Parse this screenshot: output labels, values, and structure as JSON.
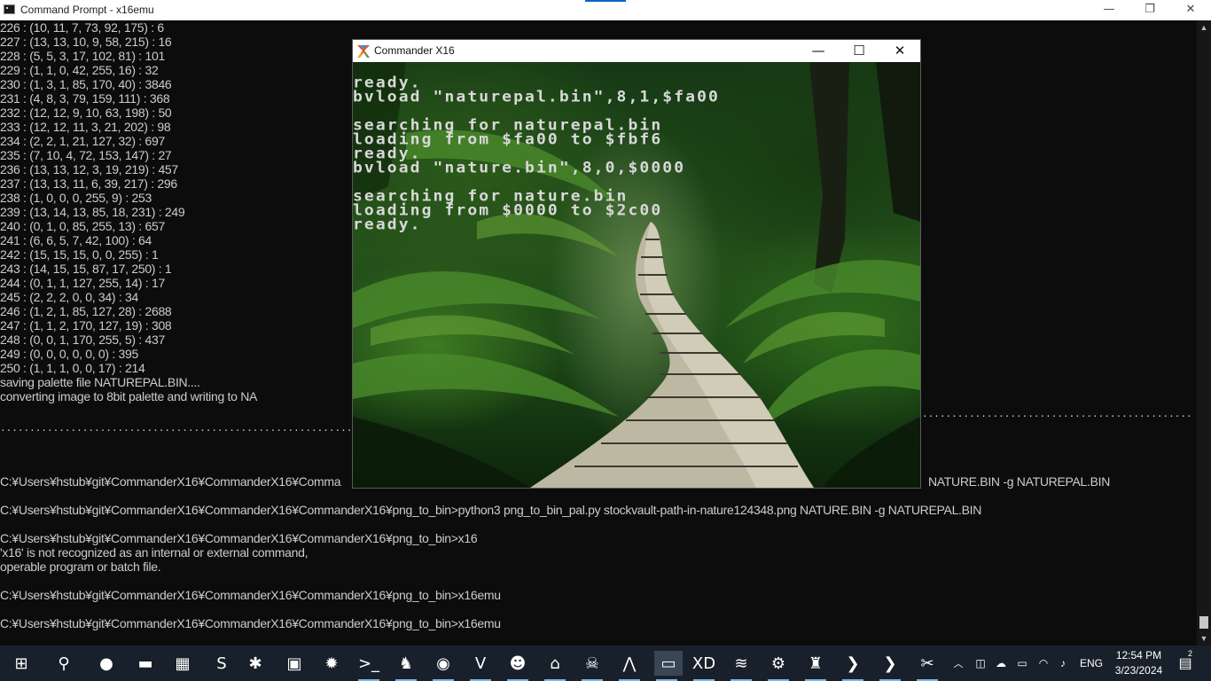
{
  "cmd_window": {
    "title": "Command Prompt - x16emu",
    "minimize": "—",
    "maximize": "❐",
    "close": "✕"
  },
  "console_lines": [
    "226 : (10, 11, 7, 73, 92, 175) : 6",
    "227 : (13, 13, 10, 9, 58, 215) : 16",
    "228 : (5, 5, 3, 17, 102, 81) : 101",
    "229 : (1, 1, 0, 42, 255, 16) : 32",
    "230 : (1, 3, 1, 85, 170, 40) : 3846",
    "231 : (4, 8, 3, 79, 159, 111) : 368",
    "232 : (12, 12, 9, 10, 63, 198) : 50",
    "233 : (12, 12, 11, 3, 21, 202) : 98",
    "234 : (2, 2, 1, 21, 127, 32) : 697",
    "235 : (7, 10, 4, 72, 153, 147) : 27",
    "236 : (13, 13, 12, 3, 19, 219) : 457",
    "237 : (13, 13, 11, 6, 39, 217) : 296",
    "238 : (1, 0, 0, 0, 255, 9) : 253",
    "239 : (13, 14, 13, 85, 18, 231) : 249",
    "240 : (0, 1, 0, 85, 255, 13) : 657",
    "241 : (6, 6, 5, 7, 42, 100) : 64",
    "242 : (15, 15, 15, 0, 0, 255) : 1",
    "243 : (14, 15, 15, 87, 17, 250) : 1",
    "244 : (0, 1, 1, 127, 255, 14) : 17",
    "245 : (2, 2, 2, 0, 0, 34) : 34",
    "246 : (1, 2, 1, 85, 127, 28) : 2688",
    "247 : (1, 1, 2, 170, 127, 19) : 308",
    "248 : (0, 0, 1, 170, 255, 5) : 437",
    "249 : (0, 0, 0, 0, 0, 0) : 395",
    "250 : (1, 1, 1, 0, 0, 17) : 214",
    "saving palette file NATUREPAL.BIN....",
    "converting image to 8bit palette and writing to NA"
  ],
  "console_commands": {
    "partial_left": "C:¥Users¥hstub¥git¥CommanderX16¥CommanderX16¥Comma",
    "partial_right": "NATURE.BIN -g NATUREPAL.BIN",
    "python_cmd": "C:¥Users¥hstub¥git¥CommanderX16¥CommanderX16¥CommanderX16¥png_to_bin>python3 png_to_bin_pal.py stockvault-path-in-nature124348.png NATURE.BIN -g NATUREPAL.BIN",
    "x16_cmd": "C:¥Users¥hstub¥git¥CommanderX16¥CommanderX16¥CommanderX16¥png_to_bin>x16",
    "error_1": "'x16' is not recognized as an internal or external command,",
    "error_2": "operable program or batch file.",
    "emu_cmd_1": "C:¥Users¥hstub¥git¥CommanderX16¥CommanderX16¥CommanderX16¥png_to_bin>x16emu",
    "emu_cmd_2": "C:¥Users¥hstub¥git¥CommanderX16¥CommanderX16¥CommanderX16¥png_to_bin>x16emu"
  },
  "x16_window": {
    "title": "Commander X16",
    "minimize": "—",
    "maximize": "☐",
    "close": "✕",
    "screen_lines": [
      "ready.",
      "bvload \"naturepal.bin\",8,1,$fa00",
      "",
      "searching for naturepal.bin",
      "loading from $fa00 to $fbf6",
      "ready.",
      "bvload \"nature.bin\",8,0,$0000",
      "",
      "searching for nature.bin",
      "loading from $0000 to $2c00",
      "ready."
    ]
  },
  "taskbar": {
    "clock_time": "12:54 PM",
    "clock_date": "3/23/2024",
    "language": "ENG",
    "notification_count": "2",
    "apps": [
      {
        "name": "start-button-icon",
        "glyph": "⊞"
      },
      {
        "name": "search-icon",
        "glyph": "⚲"
      },
      {
        "name": "chrome-icon",
        "glyph": "●"
      },
      {
        "name": "file-explorer-icon",
        "glyph": "▬"
      },
      {
        "name": "calculator-icon",
        "glyph": "▦"
      },
      {
        "name": "sublime-text-icon",
        "glyph": "S"
      },
      {
        "name": "bug-app-icon",
        "glyph": "✱"
      },
      {
        "name": "chip-app-icon",
        "glyph": "▣"
      },
      {
        "name": "burst-app-icon",
        "glyph": "✹"
      },
      {
        "name": "terminal-icon",
        "glyph": ">_"
      },
      {
        "name": "game-character-icon",
        "glyph": "♞"
      },
      {
        "name": "firefox-icon",
        "glyph": "◉"
      },
      {
        "name": "vnc-viewer-icon",
        "glyph": "V"
      },
      {
        "name": "godot-icon",
        "glyph": "☻"
      },
      {
        "name": "ufo-app-icon",
        "glyph": "⌂"
      },
      {
        "name": "skull-icon",
        "glyph": "☠"
      },
      {
        "name": "inkscape-icon",
        "glyph": "⋀"
      },
      {
        "name": "x16-window-icon",
        "glyph": "▭"
      },
      {
        "name": "xd-app-icon",
        "glyph": "XD"
      },
      {
        "name": "reptile-app-icon",
        "glyph": "≋"
      },
      {
        "name": "robot-app-icon",
        "glyph": "⚙"
      },
      {
        "name": "pixel-creature-icon",
        "glyph": "♜"
      },
      {
        "name": "powershell-icon",
        "glyph": "❯"
      },
      {
        "name": "vscode-icon",
        "glyph": "❯"
      },
      {
        "name": "commander-x16-taskbar-icon",
        "glyph": "✂"
      }
    ]
  },
  "colors": {
    "console_bg": "#0c0c0c",
    "console_text": "#cccccc",
    "x16_text": "#d8d8d8",
    "taskbar_bg": "#18212b"
  }
}
